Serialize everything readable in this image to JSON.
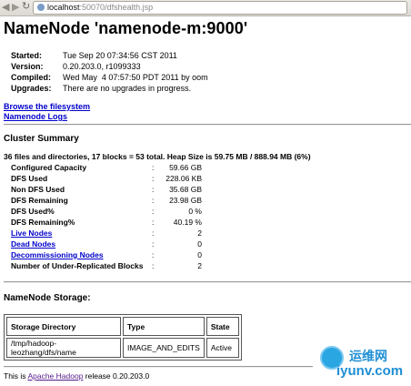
{
  "browser": {
    "url_host": "localhost",
    "url_rest": ":50070/dfshealth.jsp"
  },
  "page": {
    "title": "NameNode 'namenode-m:9000'",
    "info": [
      {
        "label": "Started:",
        "value": "Tue Sep 20 07:34:56 CST 2011"
      },
      {
        "label": "Version:",
        "value": "0.20.203.0, r1099333"
      },
      {
        "label": "Compiled:",
        "value": "Wed May  4 07:57:50 PDT 2011 by oom"
      },
      {
        "label": "Upgrades:",
        "value": "There are no upgrades in progress."
      }
    ],
    "links": {
      "browse": "Browse the filesystem",
      "logs": "Namenode Logs"
    },
    "cluster_summary": {
      "heading": "Cluster Summary",
      "summary_line": "36 files and directories, 17 blocks = 53 total. Heap Size is 59.75 MB / 888.94 MB (6%)",
      "rows": [
        {
          "label": "Configured Capacity",
          "value": "59.66 GB"
        },
        {
          "label": "DFS Used",
          "value": "228.06 KB"
        },
        {
          "label": "Non DFS Used",
          "value": "35.68 GB"
        },
        {
          "label": "DFS Remaining",
          "value": "23.98 GB"
        },
        {
          "label": "DFS Used%",
          "value": "0 %"
        },
        {
          "label": "DFS Remaining%",
          "value": "40.19 %"
        },
        {
          "label": "Live Nodes",
          "value": "2"
        },
        {
          "label": "Dead Nodes",
          "value": "0"
        },
        {
          "label": "Decommissioning Nodes",
          "value": "0"
        },
        {
          "label": "Number of Under-Replicated Blocks",
          "value": "2"
        }
      ],
      "colon": ":"
    },
    "storage": {
      "heading": "NameNode Storage:",
      "headers": [
        "Storage Directory",
        "Type",
        "State"
      ],
      "row": [
        "/tmp/hadoop-leozhang/dfs/name",
        "IMAGE_AND_EDITS",
        "Active"
      ]
    },
    "footer": {
      "prefix": "This is ",
      "link": "Apache Hadoop",
      "suffix": " release 0.20.203.0"
    },
    "watermark": {
      "line1": "运维网",
      "line2": "iyunv.com"
    }
  }
}
